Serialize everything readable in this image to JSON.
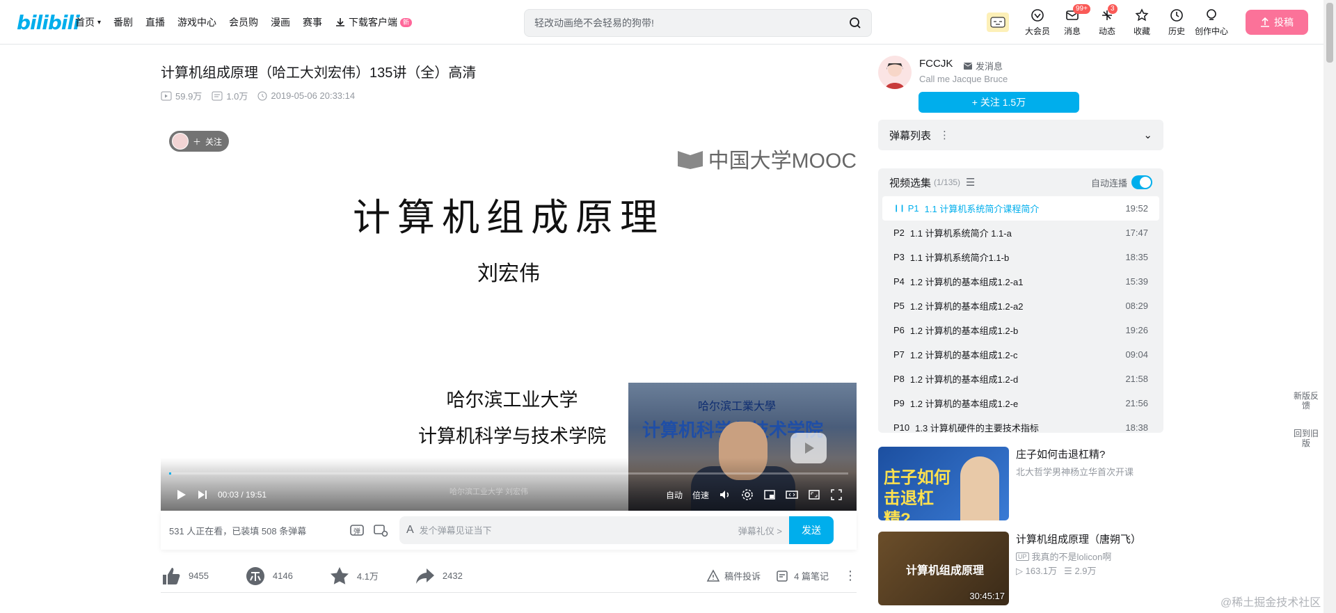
{
  "header": {
    "logo": "bilibili",
    "nav": [
      {
        "label": "首页",
        "has_chevron": true
      },
      {
        "label": "番剧"
      },
      {
        "label": "直播"
      },
      {
        "label": "游戏中心"
      },
      {
        "label": "会员购"
      },
      {
        "label": "漫画"
      },
      {
        "label": "赛事"
      },
      {
        "label": "下载客户端",
        "badge": "新"
      }
    ],
    "search_placeholder": "轻改动画绝不会轻易的狗带!",
    "right_nav": [
      {
        "label": "大会员",
        "icon": "vip-icon"
      },
      {
        "label": "消息",
        "icon": "mail-icon",
        "badge": "99+"
      },
      {
        "label": "动态",
        "icon": "wind-icon",
        "badge": "3"
      },
      {
        "label": "收藏",
        "icon": "star-icon"
      },
      {
        "label": "历史",
        "icon": "clock-icon"
      },
      {
        "label": "创作中心",
        "icon": "bulb-icon"
      }
    ],
    "upload_label": "投稿",
    "accent": "#00aeec",
    "pink": "#fb7299"
  },
  "video": {
    "title": "计算机组成原理（哈工大刘宏伟）135讲（全）高清",
    "views": "59.9万",
    "danmaku_count": "1.0万",
    "date": "2019-05-06 20:33:14"
  },
  "player": {
    "follow_chip": "关注",
    "slide_title": "计算机组成原理",
    "slide_author": "刘宏伟",
    "slide_school_1": "哈尔滨工业大学",
    "slide_school_2": "计算机科学与技术学院",
    "mooc_logo": "中国大学MOOC",
    "pip_text": "计算机科学与技术学院",
    "pip_caption": "哈尔滨工業大學",
    "watermark": "哈尔滨工业大学 刘宏伟",
    "time_current": "00:03",
    "time_total": "19:51",
    "progress_fraction": 0.003,
    "auto_label": "自动",
    "speed_label": "倍速"
  },
  "danmaku_bar": {
    "info": "531 人正在看，已装填 508 条弹幕",
    "placeholder": "发个弹幕见证当下",
    "etiquette": "弹幕礼仪 >",
    "send_label": "发送"
  },
  "toolbar": {
    "like": "9455",
    "coin": "4146",
    "fav": "4.1万",
    "share": "2432",
    "report": "稿件投诉",
    "notes": "4 篇笔记"
  },
  "uploader": {
    "name": "FCCJK",
    "msg_label": "发消息",
    "signature": "Call me Jacque Bruce",
    "follow_label": "+ 关注 1.5万"
  },
  "danmaku_list": {
    "label": "弹幕列表"
  },
  "episodes": {
    "label": "视频选集",
    "count": "(1/135)",
    "autoplay_label": "自动连播",
    "items": [
      {
        "p": "P1",
        "title": "1.1 计算机系统简介课程简介",
        "dur": "19:52",
        "active": true
      },
      {
        "p": "P2",
        "title": "1.1 计算机系统简介 1.1-a",
        "dur": "17:47"
      },
      {
        "p": "P3",
        "title": "1.1 计算机系统简介1.1-b",
        "dur": "18:35"
      },
      {
        "p": "P4",
        "title": "1.2 计算机的基本组成1.2-a1",
        "dur": "15:39"
      },
      {
        "p": "P5",
        "title": "1.2 计算机的基本组成1.2-a2",
        "dur": "08:29"
      },
      {
        "p": "P6",
        "title": "1.2 计算机的基本组成1.2-b",
        "dur": "19:26"
      },
      {
        "p": "P7",
        "title": "1.2 计算机的基本组成1.2-c",
        "dur": "09:04"
      },
      {
        "p": "P8",
        "title": "1.2 计算机的基本组成1.2-d",
        "dur": "21:58"
      },
      {
        "p": "P9",
        "title": "1.2 计算机的基本组成1.2-e",
        "dur": "21:56"
      },
      {
        "p": "P10",
        "title": "1.3 计算机硬件的主要技术指标",
        "dur": "18:38"
      }
    ]
  },
  "recommendations": [
    {
      "title": "庄子如何击退杠精?",
      "author": "北大哲学男神杨立华首次开课",
      "thumb_text": "庄子如何击退杠精?"
    },
    {
      "title": "计算机组成原理（唐朔飞）",
      "author": "我真的不是lolicon啊",
      "views": "163.1万",
      "danmaku": "2.9万",
      "duration": "30:45:17",
      "thumb_text": "计算机组成原理"
    }
  ],
  "side_buttons": {
    "new_feedback": "新版反馈",
    "old_version": "回到旧版"
  },
  "watermark_text": "@稀土掘金技术社区"
}
